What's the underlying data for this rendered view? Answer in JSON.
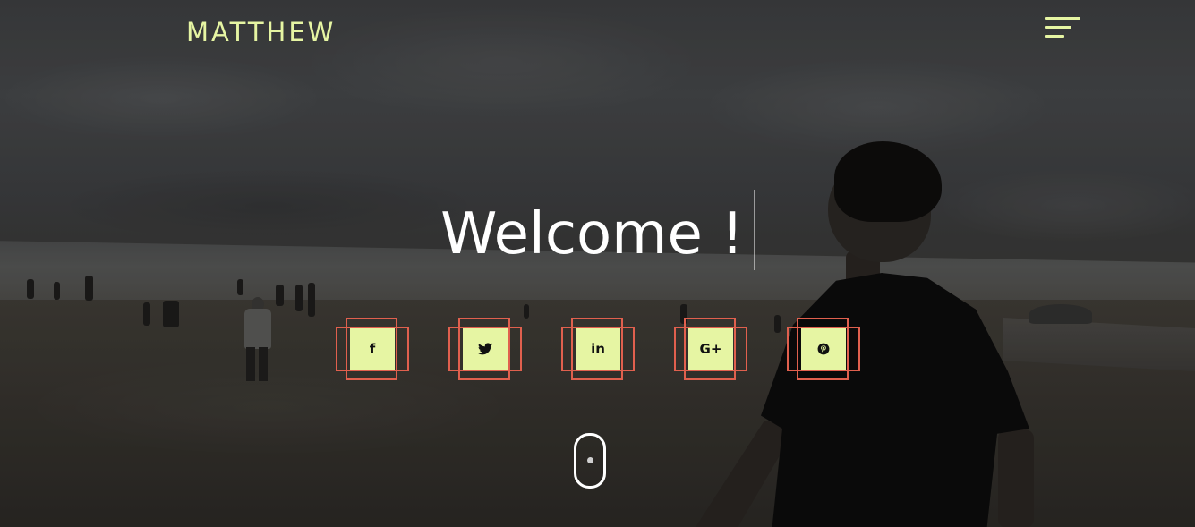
{
  "header": {
    "brand": "MATTHEW",
    "menu_icon": "hamburger-menu-icon"
  },
  "hero": {
    "title": "Welcome !"
  },
  "socials": [
    {
      "icon": "facebook-icon",
      "glyph": "f"
    },
    {
      "icon": "twitter-icon"
    },
    {
      "icon": "linkedin-icon",
      "glyph": "in"
    },
    {
      "icon": "google-plus-icon",
      "glyph": "G+"
    },
    {
      "icon": "pinterest-icon"
    }
  ],
  "scroll_indicator": {
    "icon": "scroll-mouse-icon"
  },
  "colors": {
    "accent": "#e6f5a3",
    "frame": "#e0604e",
    "text": "#ffffff"
  }
}
